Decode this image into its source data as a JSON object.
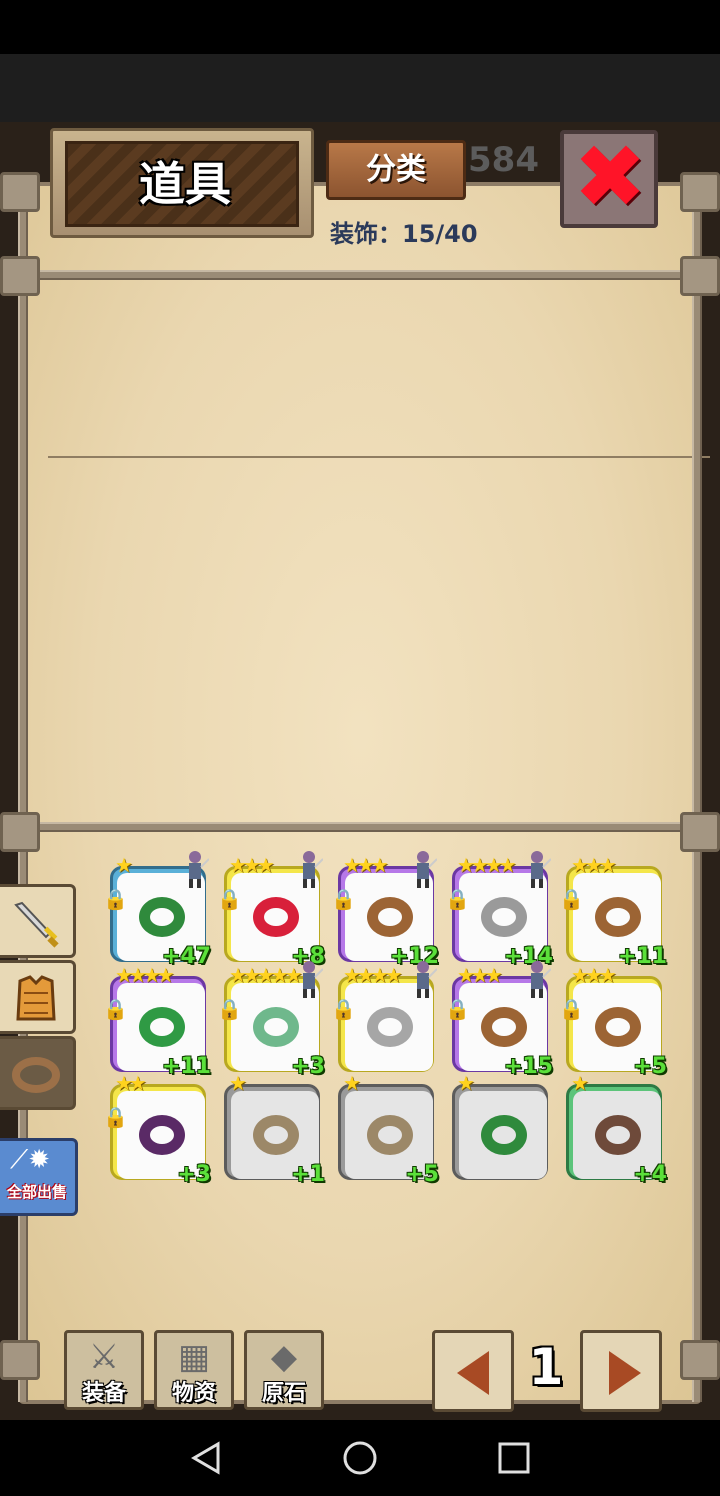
{
  "header": {
    "title": "道具",
    "category_button": "分类",
    "capacity_label": "装饰：15/40",
    "background_number": "584"
  },
  "side_tabs": [
    {
      "name": "weapon-tab",
      "icon": "sword-icon"
    },
    {
      "name": "armor-tab",
      "icon": "armor-icon"
    },
    {
      "name": "accessory-tab",
      "icon": "ring-icon"
    }
  ],
  "sell_all_label": "全部出售",
  "items": [
    {
      "frame": "blue",
      "ring_color": "#2f8a3c",
      "stars": "★",
      "locked": true,
      "level": "+47",
      "hero": true
    },
    {
      "frame": "yellow",
      "ring_color": "#d8203a",
      "stars": "★★★",
      "locked": true,
      "level": "+8",
      "hero": true
    },
    {
      "frame": "purple",
      "ring_color": "#9c6434",
      "stars": "★★★",
      "locked": true,
      "level": "+12",
      "hero": true
    },
    {
      "frame": "purple",
      "ring_color": "#9a9a9a",
      "stars": "★★★★",
      "locked": true,
      "level": "+14",
      "hero": true
    },
    {
      "frame": "yellow",
      "ring_color": "#9c6434",
      "stars": "★★★",
      "locked": true,
      "level": "+11",
      "hero": false
    },
    {
      "frame": "purple",
      "ring_color": "#2f9a44",
      "stars": "★★★★",
      "locked": true,
      "level": "+11",
      "hero": false
    },
    {
      "frame": "yellow",
      "ring_color": "#6fb88c",
      "stars": "★★★★★",
      "locked": true,
      "level": "+3",
      "hero": true
    },
    {
      "frame": "yellow",
      "ring_color": "#a6a6a6",
      "stars": "★★★★",
      "locked": true,
      "level": "",
      "hero": true
    },
    {
      "frame": "purple",
      "ring_color": "#9c6434",
      "stars": "★★★",
      "locked": true,
      "level": "+15",
      "hero": true
    },
    {
      "frame": "yellow",
      "ring_color": "#9c6434",
      "stars": "★★★",
      "locked": true,
      "level": "+5",
      "hero": false
    },
    {
      "frame": "yellow",
      "ring_color": "#5a2a66",
      "stars": "★★",
      "locked": true,
      "level": "+3",
      "hero": false
    },
    {
      "frame": "gray",
      "ring_color": "#9c8868",
      "stars": "★",
      "locked": false,
      "level": "+1",
      "hero": false
    },
    {
      "frame": "gray",
      "ring_color": "#9c8868",
      "stars": "★",
      "locked": false,
      "level": "+5",
      "hero": false
    },
    {
      "frame": "gray",
      "ring_color": "#2f8a3c",
      "stars": "★",
      "locked": false,
      "level": "",
      "hero": false
    },
    {
      "frame": "green",
      "ring_color": "#6e4a3a",
      "stars": "★",
      "locked": false,
      "level": "+4",
      "hero": false
    }
  ],
  "bottom_tabs": [
    {
      "label": "装备",
      "icon": "crossed-swords-icon"
    },
    {
      "label": "物资",
      "icon": "crate-icon"
    },
    {
      "label": "原石",
      "icon": "crystal-icon"
    }
  ],
  "pagination": {
    "page": "1"
  }
}
